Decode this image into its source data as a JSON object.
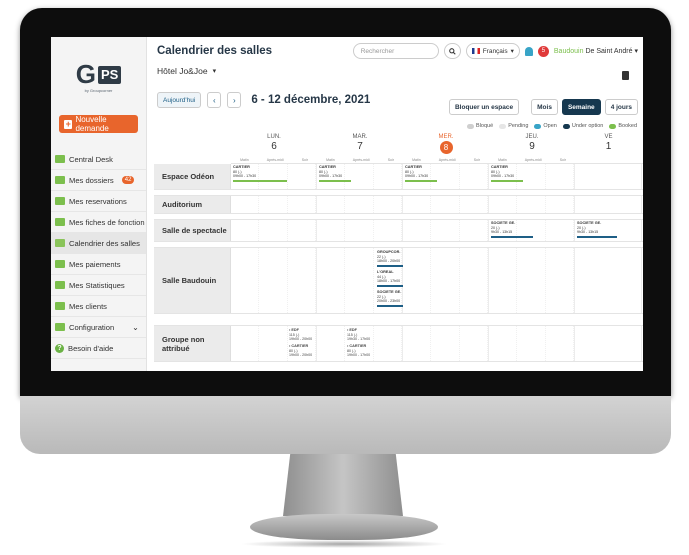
{
  "app": {
    "logo_main": "G",
    "logo_box": "PS",
    "logo_sub": "by Groupcorner",
    "title": "Calendrier des salles",
    "hotel": "Hôtel Jo&Joe"
  },
  "sidebar": {
    "new_request": "Nouvelle demande",
    "items": [
      {
        "label": "Central Desk",
        "icon": "list-icon"
      },
      {
        "label": "Mes dossiers",
        "icon": "folder-icon",
        "badge": "42"
      },
      {
        "label": "Mes reservations",
        "icon": "reservation-icon"
      },
      {
        "label": "Mes fiches de fonction",
        "icon": "document-icon"
      },
      {
        "label": "Calendrier des salles",
        "icon": "calendar-icon"
      },
      {
        "label": "Mes paiements",
        "icon": "card-icon"
      },
      {
        "label": "Mes Statistiques",
        "icon": "chart-icon"
      },
      {
        "label": "Mes clients",
        "icon": "users-icon"
      },
      {
        "label": "Configuration",
        "icon": "gear-icon"
      },
      {
        "label": "Besoin d'aide",
        "icon": "help-icon"
      }
    ]
  },
  "header": {
    "search_placeholder": "Rechercher",
    "language": "Français",
    "notifications": "5",
    "user_first": "Baudouin",
    "user_last": "De Saint André"
  },
  "toolbar": {
    "today": "Aujourd'hui",
    "prev": "‹",
    "next": "›",
    "date_range": "6 - 12 décembre, 2021",
    "block_space": "Bloquer un espace",
    "month": "Mois",
    "week": "Semaine",
    "four_days": "4 jours"
  },
  "legend": {
    "blocked": "Bloqué",
    "pending": "Pending",
    "open": "Open",
    "under_option": "Under option",
    "booked": "Booked",
    "colors": {
      "blocked": "#cfcfcf",
      "pending": "#e6e6e6",
      "open": "#38a4c7",
      "under_option": "#16384f",
      "booked": "#7cbf4d"
    }
  },
  "days": [
    {
      "name": "LUN.",
      "num": "6"
    },
    {
      "name": "MAR.",
      "num": "7"
    },
    {
      "name": "MER.",
      "num": "8"
    },
    {
      "name": "JEU.",
      "num": "9"
    },
    {
      "name": "VE",
      "num": "1"
    }
  ],
  "slots": [
    "Matin",
    "Après-midi",
    "Soir"
  ],
  "rooms": [
    "Espace Odéon",
    "Auditorium",
    "Salle de spectacle",
    "Salle Baudouin",
    "Groupe non attribué"
  ],
  "events": {
    "cartier": {
      "name": "CARTIER",
      "pax": "80 (-)",
      "time": "09h00 - 17h30"
    },
    "societe": {
      "name": "SOCIETE GE.",
      "pax": "20 (-)",
      "time": "9h30 - 13h15"
    },
    "groupcor": {
      "name": "GROUPCOR.",
      "pax": "22 (-)",
      "time": "18h00 - 20h00"
    },
    "loreal": {
      "name": "L'OREAL",
      "pax": "44 (-)",
      "time": "18h00 - 17h00"
    },
    "societe2": {
      "name": "SOCIETE GE.",
      "pax": "22 (-)",
      "time": "20h00 - 23h00"
    },
    "edf": {
      "name": "• EDF",
      "pax": "115 (-)",
      "time": "19h00 - 20h00"
    },
    "edf2": {
      "name": "• EDF",
      "pax": "115 (-)",
      "time": "19h30 - 17h00"
    },
    "cartier2": {
      "name": "• CARTIER",
      "pax": "80 (-)",
      "time": "19h00 - 20h00"
    },
    "cartier3": {
      "name": "• CARTIER",
      "pax": "80 (-)",
      "time": "19h00 - 17h00"
    }
  }
}
